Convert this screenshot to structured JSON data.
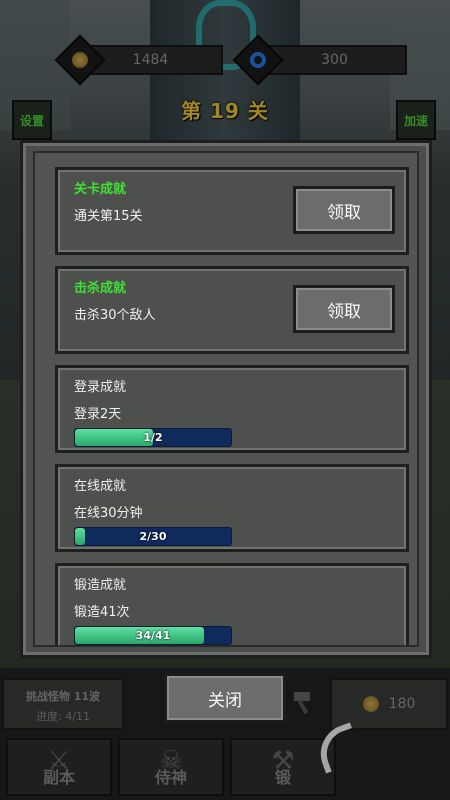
{
  "hud": {
    "gold_amount": "1484",
    "gem_amount": "300",
    "stage_title": "第 19 关",
    "settings_label": "设置",
    "speed_label": "加速"
  },
  "modal": {
    "achievements": [
      {
        "title": "关卡成就",
        "desc": "通关第15关",
        "claimable": true,
        "button": "领取"
      },
      {
        "title": "击杀成就",
        "desc": "击杀30个敌人",
        "claimable": true,
        "button": "领取"
      },
      {
        "title": "登录成就",
        "desc": "登录2天",
        "claimable": false,
        "progress_text": "1/2",
        "progress": 0.5
      },
      {
        "title": "在线成就",
        "desc": "在线30分钟",
        "claimable": false,
        "progress_text": "2/30",
        "progress": 0.067
      },
      {
        "title": "锻造成就",
        "desc": "锻造41次",
        "claimable": false,
        "progress_text": "34/41",
        "progress": 0.83
      }
    ],
    "close_label": "关闭"
  },
  "bottom": {
    "challenge_title": "挑战怪物 11波",
    "challenge_progress": "进度: 4/11",
    "coin_amount": "180",
    "nav": [
      "副本",
      "侍神",
      "锻"
    ]
  },
  "colors": {
    "title_gold": "#f4cf3b",
    "done_green": "#3fe033",
    "hud_green": "#52d63b",
    "progress_bg": "#0f2a5c",
    "progress_fill": "#29a86a"
  }
}
